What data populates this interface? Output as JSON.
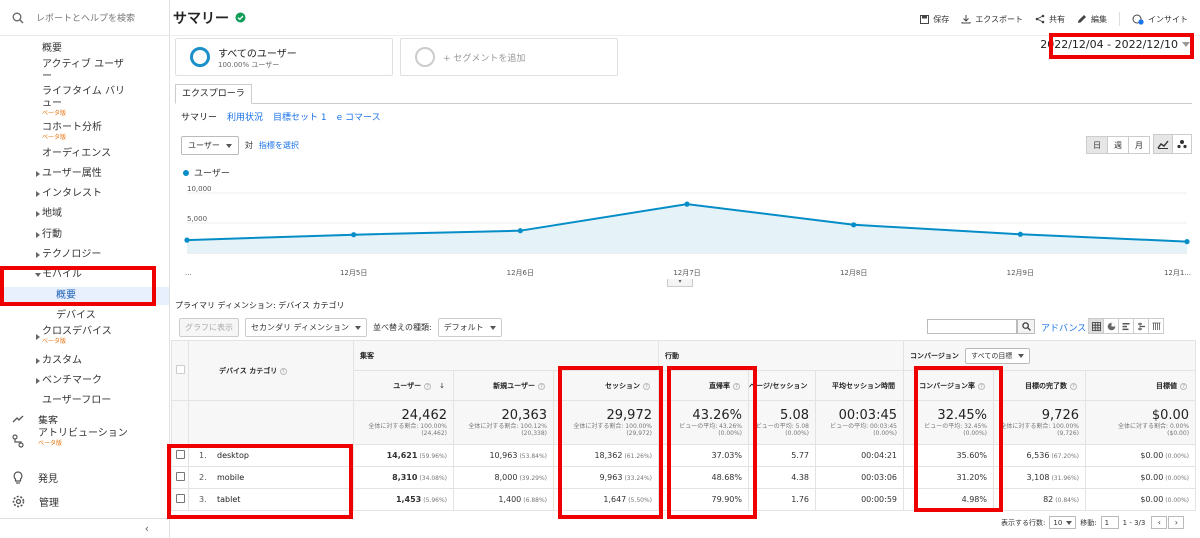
{
  "sidebar": {
    "search_placeholder": "レポートとヘルプを検索",
    "items": [
      {
        "label": "概要"
      },
      {
        "label": "アクティブ ユーザー"
      },
      {
        "label": "ライフタイム バリュー",
        "badge": "ベータ版"
      },
      {
        "label": "コホート分析",
        "badge": "ベータ版"
      },
      {
        "label": "オーディエンス"
      },
      {
        "label": "ユーザー属性"
      },
      {
        "label": "インタレスト"
      },
      {
        "label": "地域"
      },
      {
        "label": "行動"
      },
      {
        "label": "テクノロジー"
      },
      {
        "label": "モバイル"
      },
      {
        "label": "概要"
      },
      {
        "label": "デバイス"
      },
      {
        "label": "クロスデバイス",
        "badge": "ベータ版"
      },
      {
        "label": "カスタム"
      },
      {
        "label": "ベンチマーク"
      },
      {
        "label": "ユーザーフロー"
      }
    ],
    "bottom": [
      {
        "label": "集客"
      },
      {
        "label": "アトリビューション",
        "badge": "ベータ版"
      },
      {
        "label": "発見"
      },
      {
        "label": "管理"
      }
    ]
  },
  "header": {
    "title": "サマリー",
    "actions": {
      "save": "保存",
      "export": "エクスポート",
      "share": "共有",
      "edit": "編集",
      "insight": "インサイト"
    }
  },
  "segments": {
    "all_title": "すべてのユーザー",
    "all_sub": "100.00% ユーザー",
    "add": "+ セグメントを追加"
  },
  "date_range": "2022/12/04 - 2022/12/10",
  "explorer": {
    "tab": "エクスプローラ",
    "subtabs": [
      "サマリー",
      "利用状況",
      "目標セット 1",
      "e コマース"
    ]
  },
  "metric_picker": {
    "metric": "ユーザー",
    "vs": "対",
    "select": "指標を選択"
  },
  "period_buttons": [
    "日",
    "週",
    "月"
  ],
  "chart_data": {
    "type": "area",
    "series": [
      {
        "name": "ユーザー",
        "values": [
          2150,
          3050,
          3720,
          8150,
          4700,
          3120,
          1900
        ]
      }
    ],
    "x": [
      "2022-12-04",
      "2022-12-05",
      "2022-12-06",
      "2022-12-07",
      "2022-12-08",
      "2022-12-09",
      "2022-12-10"
    ],
    "x_tick_labels": [
      "...",
      "12月5日",
      "12月6日",
      "12月7日",
      "12月8日",
      "12月9日",
      "12月1..."
    ],
    "y_tick_labels": [
      "10,000",
      "5,000"
    ],
    "y_ticks": [
      10000,
      5000
    ],
    "ylim": [
      0,
      11000
    ],
    "color": "#058dc7",
    "fill": "#e5f2f8",
    "legend": "top-left",
    "grid": true
  },
  "primary_dimension": {
    "label": "プライマリ ディメンション:",
    "value": "デバイス カテゴリ"
  },
  "toolbar": {
    "plot": "グラフに表示",
    "secondary": "セカンダリ ディメンション",
    "sort_label": "並べ替えの種類:",
    "sort_value": "デフォルト",
    "advanced": "アドバンス"
  },
  "table": {
    "dim_header": "デバイス カテゴリ",
    "groups": {
      "acq": "集客",
      "beh": "行動",
      "conv": "コンバージョン",
      "conv_select": "すべての目標"
    },
    "columns": [
      "ユーザー",
      "新規ユーザー",
      "セッション",
      "直帰率",
      "ページ/セッション",
      "平均セッション時間",
      "コンバージョン率",
      "目標の完了数",
      "目標値"
    ],
    "totals": [
      {
        "value": "24,462",
        "sub1": "全体に対する割合: 100.00%",
        "sub2": "(24,462)"
      },
      {
        "value": "20,363",
        "sub1": "全体に対する割合: 100.12%",
        "sub2": "(20,338)"
      },
      {
        "value": "29,972",
        "sub1": "全体に対する割合: 100.00%",
        "sub2": "(29,972)"
      },
      {
        "value": "43.26%",
        "sub1": "ビューの平均: 43.26%",
        "sub2": "(0.00%)"
      },
      {
        "value": "5.08",
        "sub1": "ビューの平均: 5.08",
        "sub2": "(0.00%)"
      },
      {
        "value": "00:03:45",
        "sub1": "ビューの平均: 00:03:45",
        "sub2": "(0.00%)"
      },
      {
        "value": "32.45%",
        "sub1": "ビューの平均: 32.45%",
        "sub2": "(0.00%)"
      },
      {
        "value": "9,726",
        "sub1": "全体に対する割合: 100.00%",
        "sub2": "(9,726)"
      },
      {
        "value": "$0.00",
        "sub1": "全体に対する割合: 0.00%",
        "sub2": "($0.00)"
      }
    ],
    "rows": [
      {
        "num": "1.",
        "name": "desktop",
        "users": "14,621",
        "users_pct": "(59.96%)",
        "new": "10,963",
        "new_pct": "(53.84%)",
        "sessions": "18,362",
        "sessions_pct": "(61.26%)",
        "bounce": "37.03%",
        "pps": "5.77",
        "dur": "00:04:21",
        "cvr": "35.60%",
        "goals": "6,536",
        "goals_pct": "(67.20%)",
        "value": "$0.00",
        "value_pct": "(0.00%)"
      },
      {
        "num": "2.",
        "name": "mobile",
        "users": "8,310",
        "users_pct": "(34.08%)",
        "new": "8,000",
        "new_pct": "(39.29%)",
        "sessions": "9,963",
        "sessions_pct": "(33.24%)",
        "bounce": "48.68%",
        "pps": "4.38",
        "dur": "00:03:06",
        "cvr": "31.20%",
        "goals": "3,108",
        "goals_pct": "(31.96%)",
        "value": "$0.00",
        "value_pct": "(0.00%)"
      },
      {
        "num": "3.",
        "name": "tablet",
        "users": "1,453",
        "users_pct": "(5.96%)",
        "new": "1,400",
        "new_pct": "(6.88%)",
        "sessions": "1,647",
        "sessions_pct": "(5.50%)",
        "bounce": "79.90%",
        "pps": "1.76",
        "dur": "00:00:59",
        "cvr": "4.98%",
        "goals": "82",
        "goals_pct": "(0.84%)",
        "value": "$0.00",
        "value_pct": "(0.00%)"
      }
    ]
  },
  "pagination": {
    "rows_label": "表示する行数:",
    "rows_value": "10",
    "goto_label": "移動:",
    "goto_value": "1",
    "range": "1 - 3/3"
  }
}
